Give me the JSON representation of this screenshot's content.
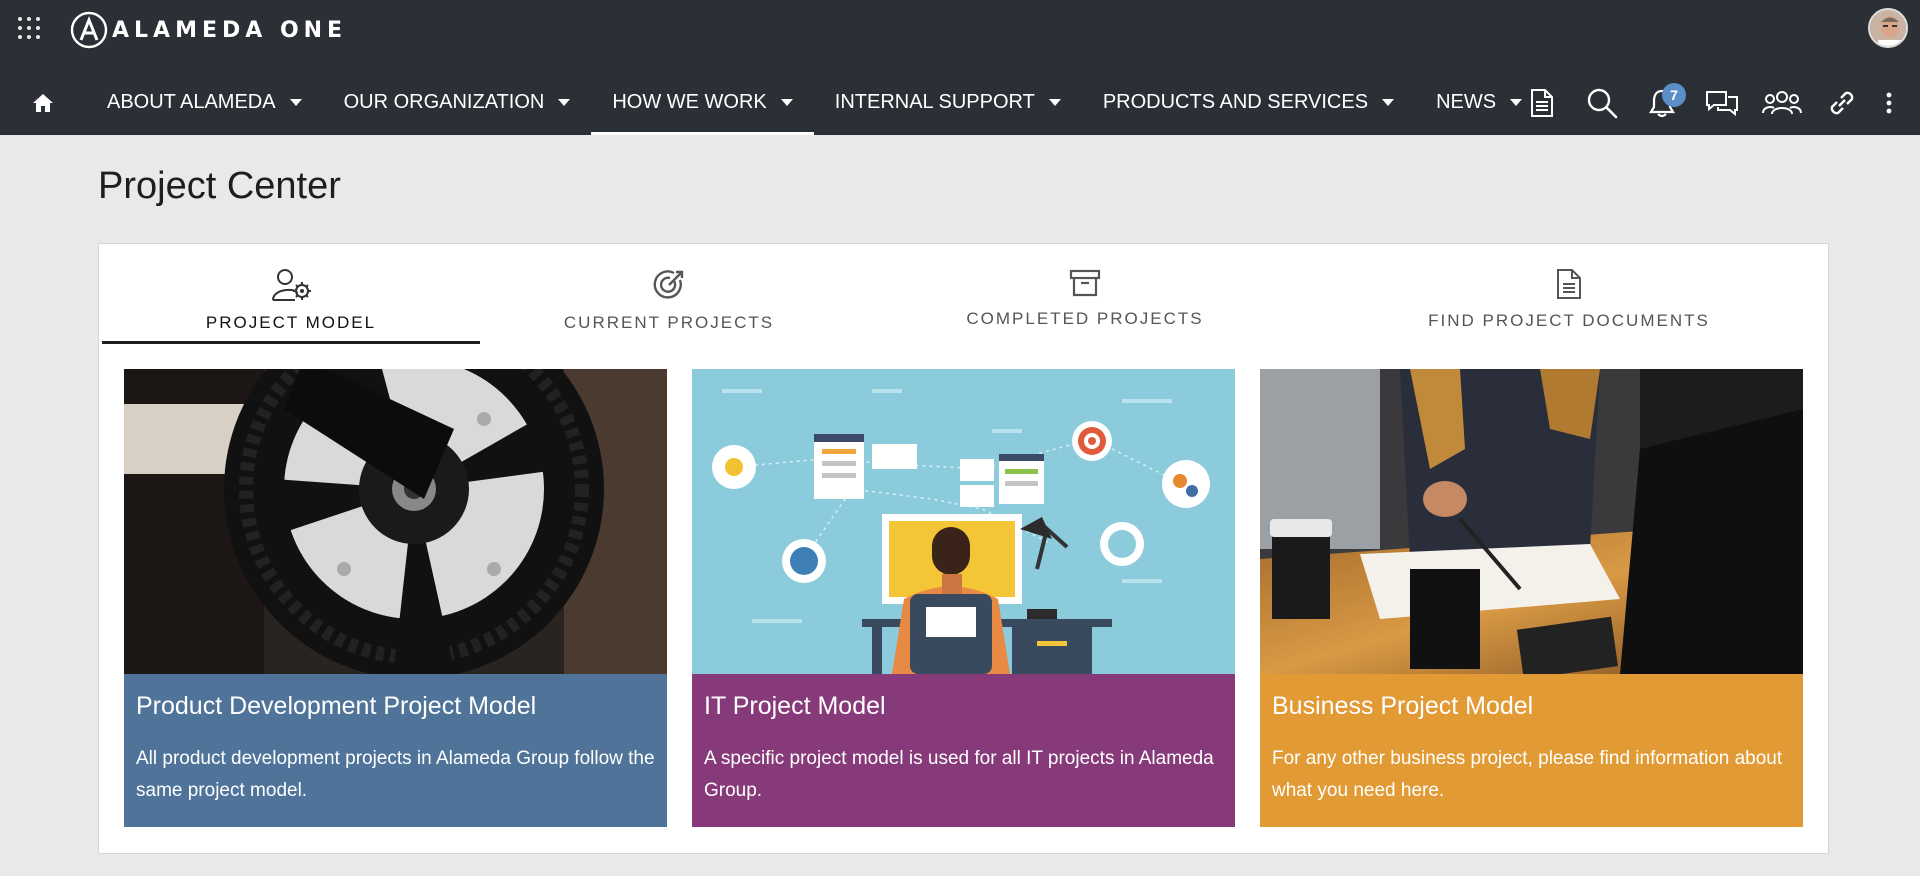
{
  "app": {
    "brand": "ALAMEDA ONE"
  },
  "nav": {
    "items": [
      {
        "label": "ABOUT ALAMEDA"
      },
      {
        "label": "OUR ORGANIZATION"
      },
      {
        "label": "HOW WE WORK"
      },
      {
        "label": "INTERNAL SUPPORT"
      },
      {
        "label": "PRODUCTS AND SERVICES"
      },
      {
        "label": "NEWS"
      }
    ],
    "active": "HOW WE WORK",
    "notification_count": "7",
    "icons": [
      "home-icon",
      "document-icon",
      "search-icon",
      "bell-icon",
      "chat-icon",
      "people-icon",
      "link-icon",
      "more-vertical-icon"
    ]
  },
  "page": {
    "title": "Project Center"
  },
  "tabs": [
    {
      "label": "PROJECT MODEL",
      "icon": "user-gear-icon"
    },
    {
      "label": "CURRENT PROJECTS",
      "icon": "target-icon"
    },
    {
      "label": "COMPLETED PROJECTS",
      "icon": "archive-icon"
    },
    {
      "label": "FIND PROJECT DOCUMENTS",
      "icon": "document-icon"
    }
  ],
  "active_tab": "PROJECT MODEL",
  "cards": [
    {
      "title": "Product Development Project Model",
      "description": "All product development projects in Alameda Group follow the same project model.",
      "color": "#4f7399"
    },
    {
      "title": "IT Project Model",
      "description": "A specific project model is used for all IT projects in Alameda Group.",
      "color": "#873a79"
    },
    {
      "title": "Business Project Model",
      "description": "For any other business project, please find information about what you need here.",
      "color": "#e19a34"
    }
  ],
  "colors": {
    "header_bg": "#2b2f36",
    "page_bg": "#e9e9e9",
    "badge": "#5b8fc9"
  }
}
